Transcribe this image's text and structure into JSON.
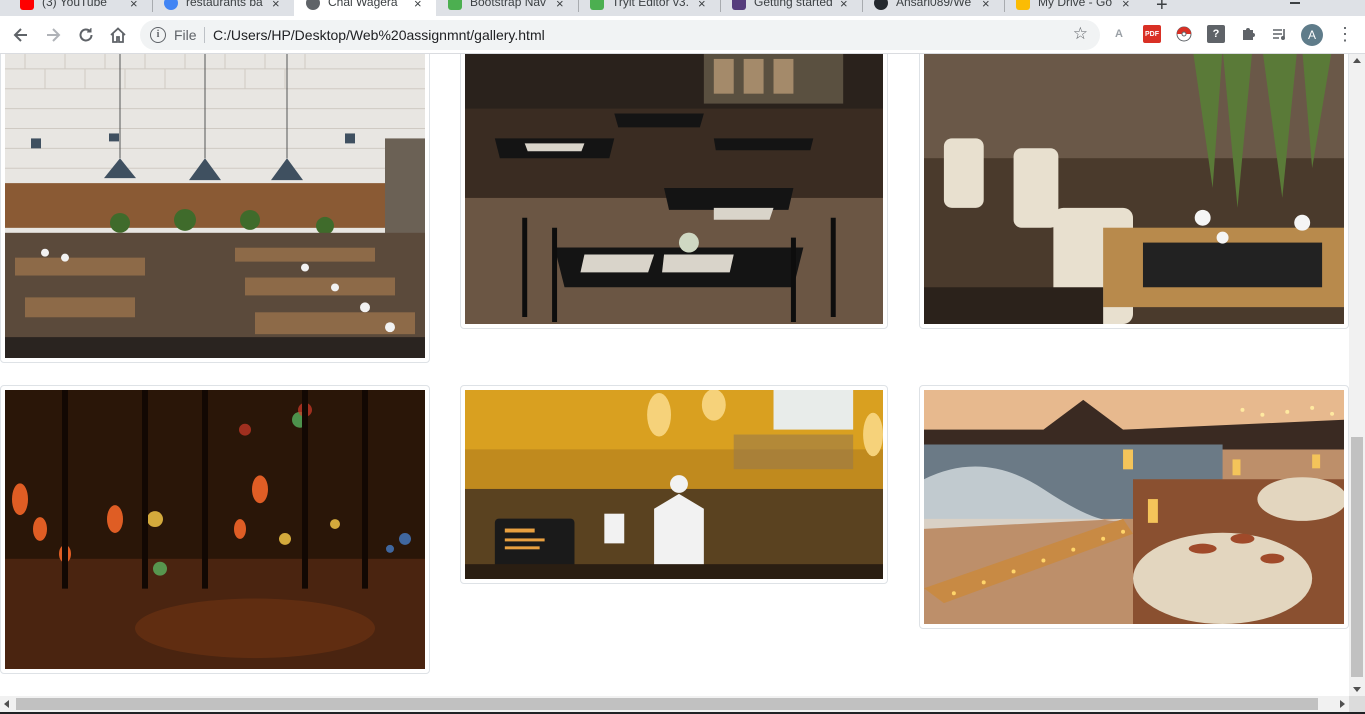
{
  "browser": {
    "tabs": [
      {
        "title": "(3) YouTube",
        "favicon": "youtube-icon",
        "color": "#ff0000"
      },
      {
        "title": "restaurants ba",
        "favicon": "google-icon",
        "color": "#4285f4"
      },
      {
        "title": "Chai Wagera",
        "favicon": "page-icon",
        "color": "#5f6368",
        "active": true
      },
      {
        "title": "Bootstrap Nav",
        "favicon": "w3schools-icon",
        "color": "#4caf50"
      },
      {
        "title": "Tryit Editor v3.",
        "favicon": "w3schools-icon",
        "color": "#4caf50"
      },
      {
        "title": "Getting started",
        "favicon": "bootstrap-icon",
        "color": "#563d7c"
      },
      {
        "title": "Ansari089/We",
        "favicon": "github-icon",
        "color": "#24292e"
      },
      {
        "title": "My Drive - Go",
        "favicon": "google-drive-icon",
        "color": "#fbbc04"
      }
    ],
    "new_tab_glyph": "+",
    "tab_close_glyph": "×",
    "address": {
      "scheme_label": "File",
      "url": "C:/Users/HP/Desktop/Web%20assignmnt/gallery.html"
    },
    "profile_initial": "A",
    "extensions": [
      {
        "name": "acrobat-extension-icon",
        "glyph": "A",
        "color": "#9aa0a6"
      },
      {
        "name": "pdf-extension-icon",
        "glyph": "PDF",
        "color": "#d93025"
      },
      {
        "name": "pokeball-extension-icon",
        "glyph": "●",
        "color": "#d93025"
      },
      {
        "name": "help-extension-icon",
        "glyph": "?",
        "color": "#5f6368"
      },
      {
        "name": "puzzle-extensions-icon",
        "glyph": "✚",
        "color": "#5f6368"
      },
      {
        "name": "media-control-icon",
        "glyph": "≡",
        "color": "#5f6368"
      }
    ]
  },
  "gallery": {
    "images": [
      {
        "name": "restaurant-interior-pendant-lamps"
      },
      {
        "name": "restaurant-interior-black-tables"
      },
      {
        "name": "restaurant-interior-white-chairs"
      },
      {
        "name": "restaurant-blurred-night-lights"
      },
      {
        "name": "restaurant-open-kitchen"
      },
      {
        "name": "restaurant-beach-dinner-sunset"
      }
    ]
  },
  "colors": {
    "card_border": "#dee2e6",
    "scrollbar_thumb": "#c1c1c1"
  }
}
